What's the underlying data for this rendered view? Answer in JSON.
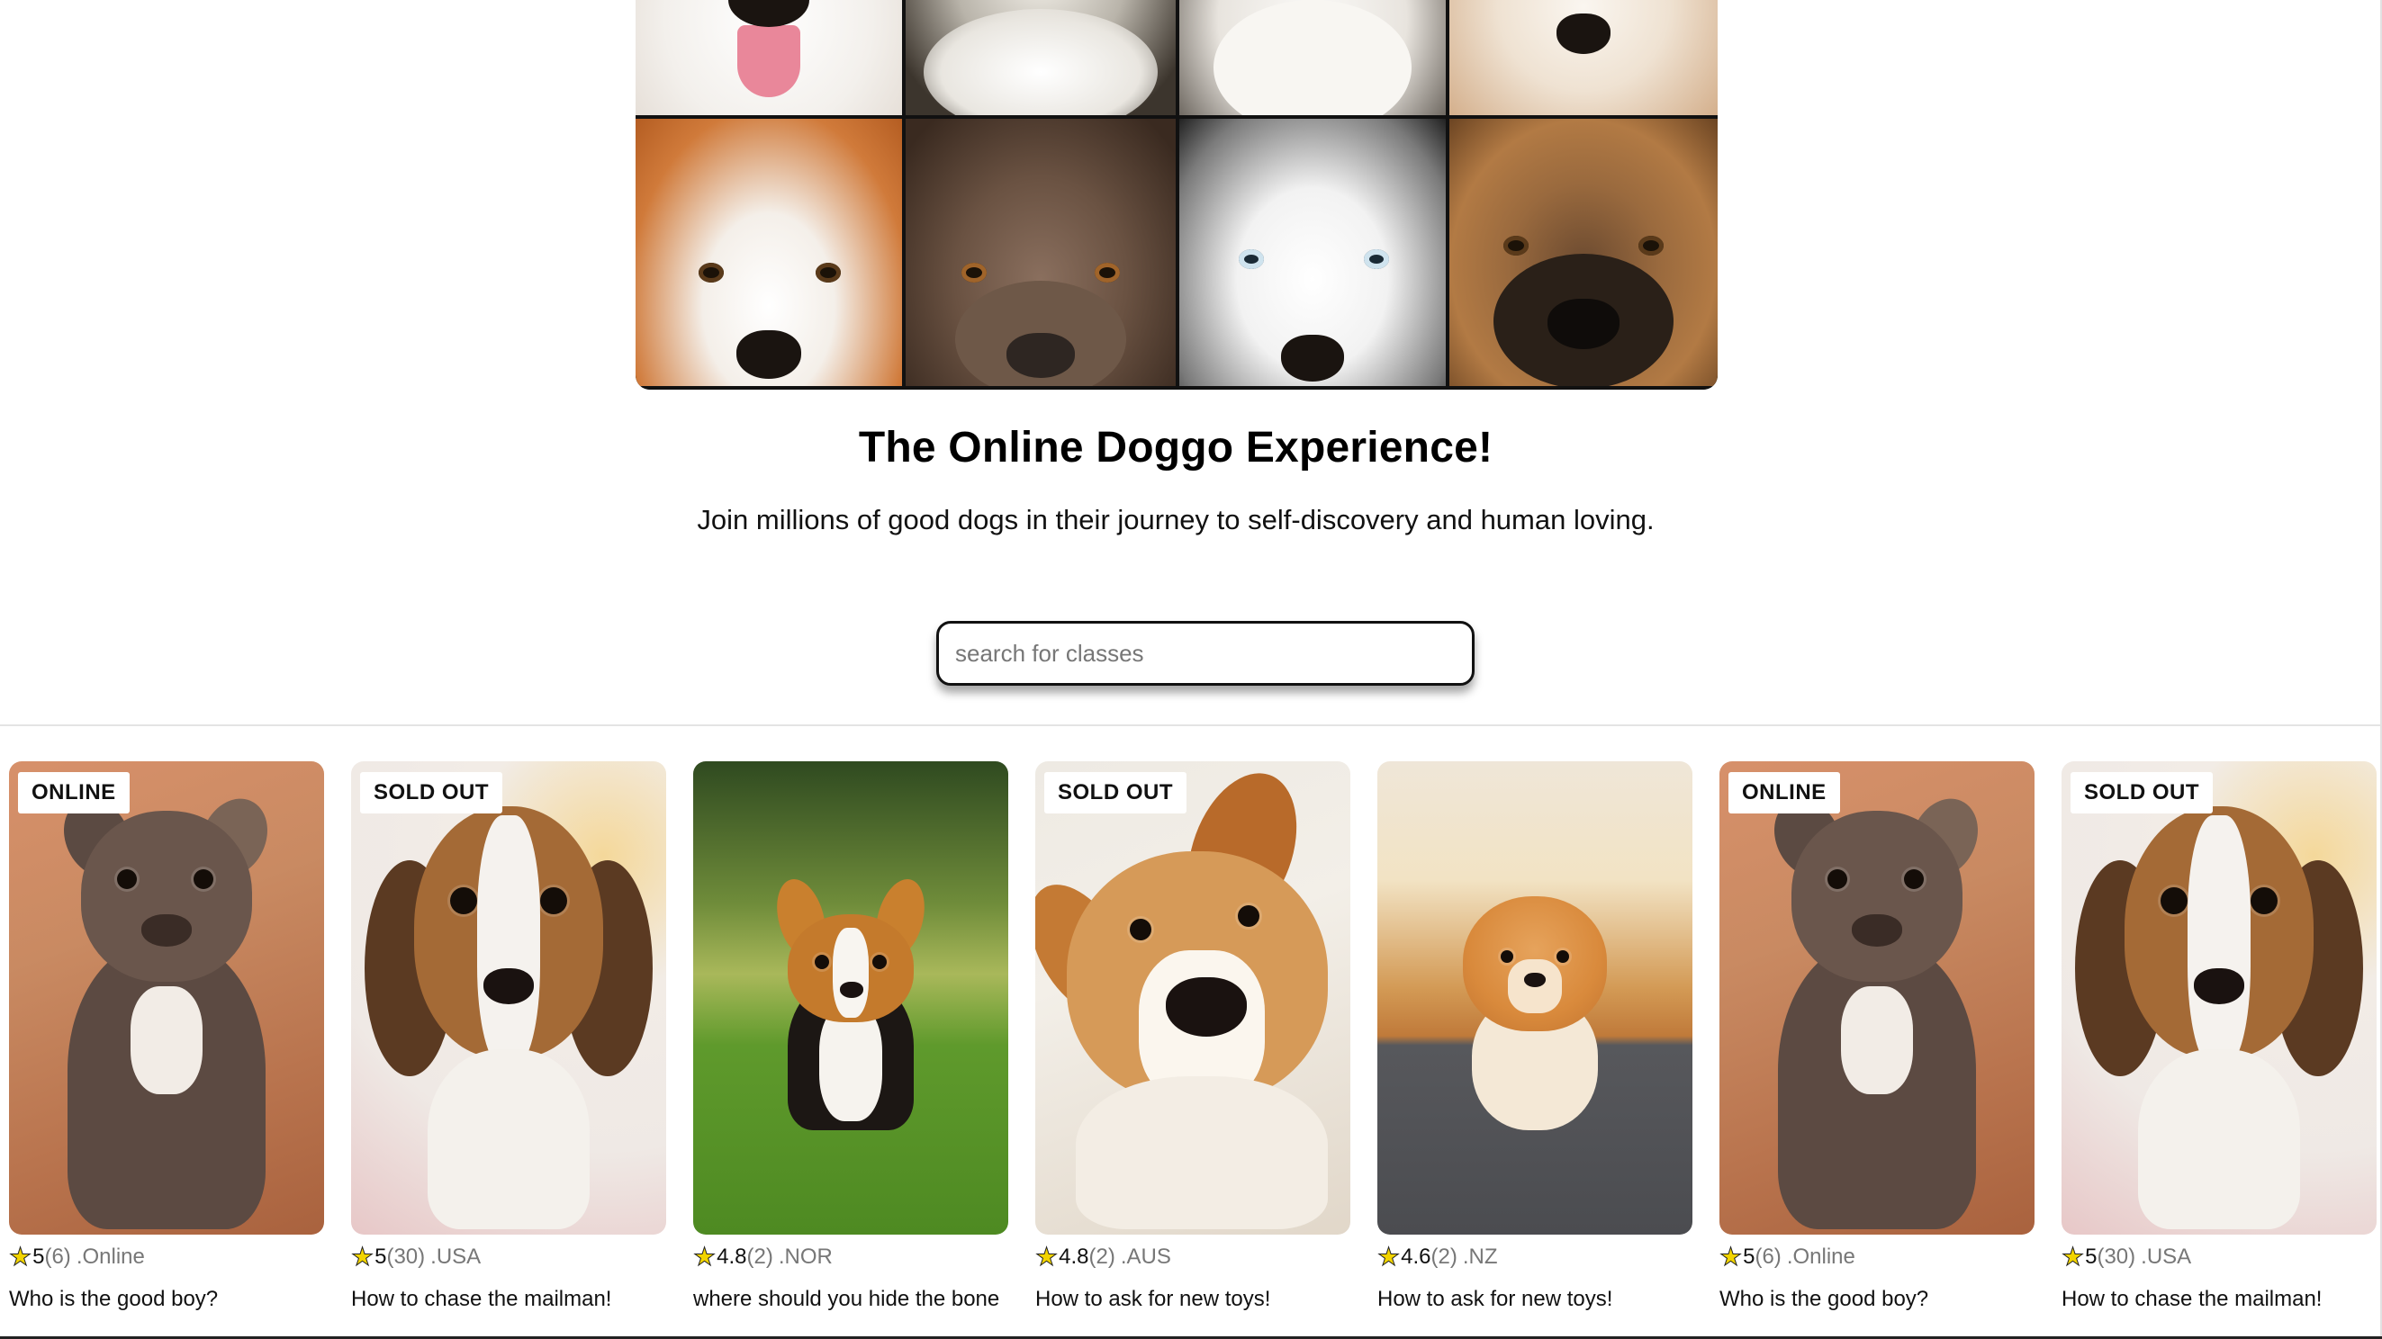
{
  "hero": {
    "alt_icons": [
      "dog-face",
      "dog-face",
      "dog-face",
      "dog-face",
      "dog-face",
      "dog-face",
      "dog-face",
      "dog-face"
    ]
  },
  "header": {
    "title": "The Online Doggo Experience!",
    "subtitle": "Join millions of good dogs in their journey to self-discovery and human loving."
  },
  "search": {
    "placeholder": "search for classes",
    "value": ""
  },
  "colors": {
    "star": "#f2d400",
    "text": "#111111",
    "muted": "#777777",
    "divider": "#e4e4e4"
  },
  "cards": [
    {
      "badge": "ONLINE",
      "rating": "5",
      "count": "(6)",
      "location": ".Online",
      "title": "Who is the good boy?",
      "photo": "pitbull-puppy"
    },
    {
      "badge": "SOLD OUT",
      "rating": "5",
      "count": "(30)",
      "location": ".USA",
      "title": "How to chase the mailman!",
      "photo": "beagle-puppy"
    },
    {
      "badge": "",
      "rating": "4.8",
      "count": "(2)",
      "location": ".NOR",
      "title": "where should you hide the bone",
      "photo": "corgi-in-grass"
    },
    {
      "badge": "SOLD OUT",
      "rating": "4.8",
      "count": "(2)",
      "location": ".AUS",
      "title": "How to ask for new toys!",
      "photo": "golden-dog-selfie"
    },
    {
      "badge": "",
      "rating": "4.6",
      "count": "(2)",
      "location": ".NZ",
      "title": "How to ask for new toys!",
      "photo": "pomeranian-on-rug"
    },
    {
      "badge": "ONLINE",
      "rating": "5",
      "count": "(6)",
      "location": ".Online",
      "title": "Who is the good boy?",
      "photo": "pitbull-puppy"
    },
    {
      "badge": "SOLD OUT",
      "rating": "5",
      "count": "(30)",
      "location": ".USA",
      "title": "How to chase the mailman!",
      "photo": "beagle-puppy"
    }
  ]
}
